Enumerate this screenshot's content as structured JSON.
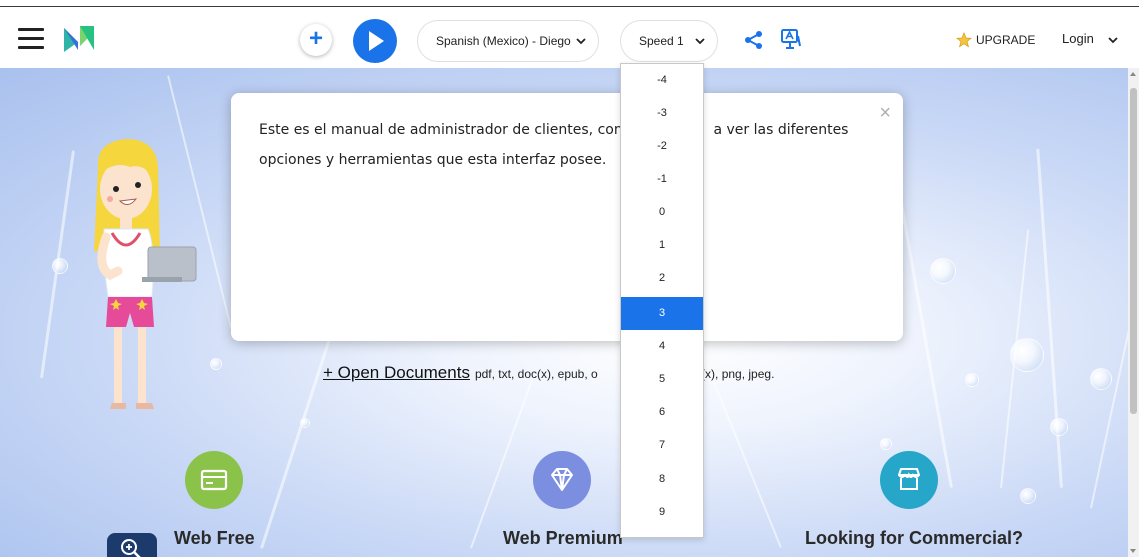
{
  "header": {
    "voice_label": "Spanish (Mexico) - Diego",
    "speed_label": "Speed 1",
    "upgrade_label": "UPGRADE",
    "login_label": "Login"
  },
  "popup": {
    "text_left": "Este es el manual de administrador de clientes, com",
    "text_right": "a ver las diferentes",
    "text_line2": "opciones y herramientas que esta interfaz posee.",
    "close_glyph": "×"
  },
  "main": {
    "open_documents_label": "+ Open Documents",
    "formats_left": "pdf, txt, doc(x), epub, o",
    "formats_right": ", ppt(x), png, jpeg."
  },
  "features": [
    {
      "title": "Web Free",
      "icon": "card-icon",
      "color": "#8bc34a"
    },
    {
      "title": "Web Premium",
      "icon": "diamond-icon",
      "color": "#7b8ee0"
    },
    {
      "title": "Looking for Commercial?",
      "icon": "store-icon",
      "color": "#26a6c9"
    }
  ],
  "speed_dropdown": {
    "options": [
      "-4",
      "-3",
      "-2",
      "-1",
      "0",
      "1",
      "2",
      "3",
      "4",
      "5",
      "6",
      "7",
      "8",
      "9"
    ],
    "selected": "3"
  },
  "colors": {
    "accent": "#1a73e8",
    "zoom_button": "#1d3a6d"
  }
}
